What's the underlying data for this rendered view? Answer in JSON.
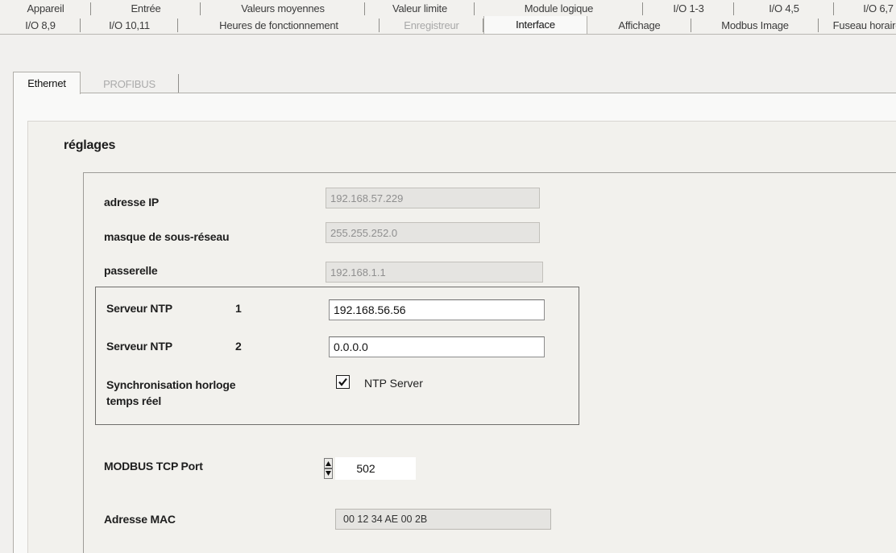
{
  "main_tabs_row1": [
    "Appareil",
    "Entrée",
    "Valeurs moyennes",
    "Valeur limite",
    "Module logique",
    "I/O 1-3",
    "I/O 4,5",
    "I/O 6,7"
  ],
  "main_tabs_row2": [
    "I/O 8,9",
    "I/O 10,11",
    "Heures de fonctionnement",
    "Enregistreur",
    "Interface",
    "Affichage",
    "Modbus Image",
    "Fuseau horaire"
  ],
  "active_tab": "Interface",
  "disabled_tabs": [
    "Enregistreur"
  ],
  "sub_tabs": [
    "Ethernet",
    "PROFIBUS"
  ],
  "active_sub_tab": "Ethernet",
  "disabled_sub_tabs": [
    "PROFIBUS"
  ],
  "settings": {
    "title": "réglages",
    "ip_label": "adresse IP",
    "ip_value": "192.168.57.229",
    "subnet_label": "masque de sous-réseau",
    "subnet_value": "255.255.252.0",
    "gateway_label": "passerelle",
    "gateway_value": "192.168.1.1",
    "ntp1_label": "Serveur NTP",
    "ntp1_index": "1",
    "ntp1_value": "192.168.56.56",
    "ntp2_label": "Serveur NTP",
    "ntp2_index": "2",
    "ntp2_value": "0.0.0.0",
    "sync_label_line1": "Synchronisation horloge",
    "sync_label_line2": "temps réel",
    "sync_checked": true,
    "sync_option_label": "NTP Server",
    "modbus_port_label": "MODBUS TCP Port",
    "modbus_port_value": "502",
    "mac_label": "Adresse MAC",
    "mac_value": "00 12 34 AE 00 2B"
  },
  "icons": {
    "checkbox_check": "check-icon",
    "spinner": "spinner-arrows-icon"
  }
}
